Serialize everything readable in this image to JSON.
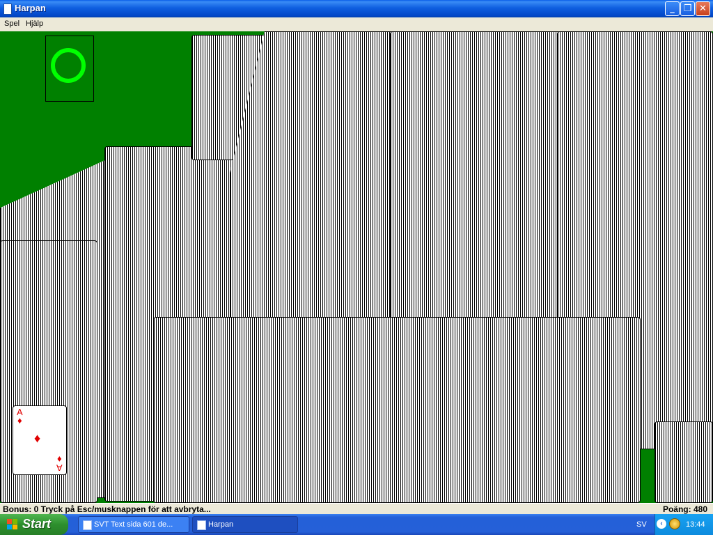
{
  "window": {
    "title": "Harpan",
    "minimize": "_",
    "maximize": "❐",
    "close": "✕"
  },
  "menu": {
    "items": [
      "Spel",
      "Hjälp"
    ]
  },
  "ace_card": {
    "rank": "A",
    "suit": "♦",
    "color": "#e00000"
  },
  "status": {
    "left": "Bonus: 0  Tryck på Esc/musknappen för att avbryta...",
    "right": "Poäng: 480"
  },
  "taskbar": {
    "start_label": "Start",
    "tasks": [
      {
        "label": "SVT Text sida 601 de...",
        "active": false
      },
      {
        "label": "Harpan",
        "active": true
      }
    ],
    "language": "SV",
    "clock": "13:44"
  },
  "colors": {
    "felt": "#008000",
    "ring": "#00ff00",
    "titlebar": "#0348c8"
  }
}
